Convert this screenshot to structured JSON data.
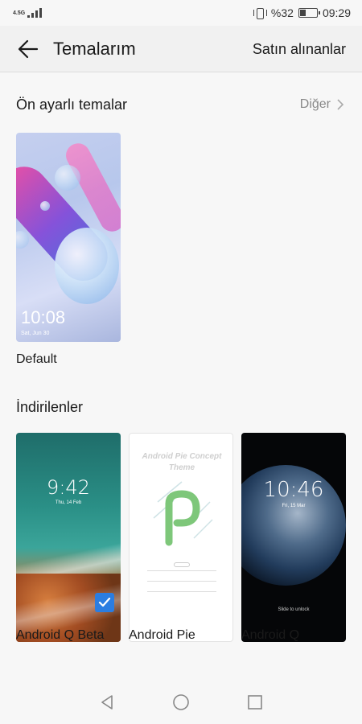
{
  "status_bar": {
    "network": "4.5G",
    "battery_percent": "%32",
    "battery_level": 0.32,
    "time": "09:29"
  },
  "header": {
    "title": "Temalarım",
    "purchased_label": "Satın alınanlar"
  },
  "preset_section": {
    "title": "Ön ayarlı temalar",
    "more_label": "Diğer",
    "themes": [
      {
        "name": "Default",
        "clock": "10:08",
        "date": "Sat, Jun 30"
      }
    ]
  },
  "downloaded_section": {
    "title": "İndirilenler",
    "themes": [
      {
        "name": "Android Q Beta",
        "clock": "9:42",
        "date": "Thu, 14 Feb",
        "selected": true
      },
      {
        "name": "Android Pie",
        "preview_title": "Android Pie Concept Theme"
      },
      {
        "name": "Android Q",
        "clock": "10:46",
        "date": "Fri, 15 Mar",
        "unlock_hint": "Slide to unlock"
      }
    ]
  },
  "colors": {
    "accent": "#2a7de1",
    "background": "#f7f7f7",
    "header_bg": "#f1f1f1",
    "secondary_text": "#888888"
  },
  "icons": {
    "back": "arrow-left-icon",
    "more": "chevron-right-icon",
    "selected": "checkmark-icon",
    "nav_back": "triangle-back-icon",
    "nav_home": "circle-home-icon",
    "nav_recent": "square-recent-icon"
  }
}
